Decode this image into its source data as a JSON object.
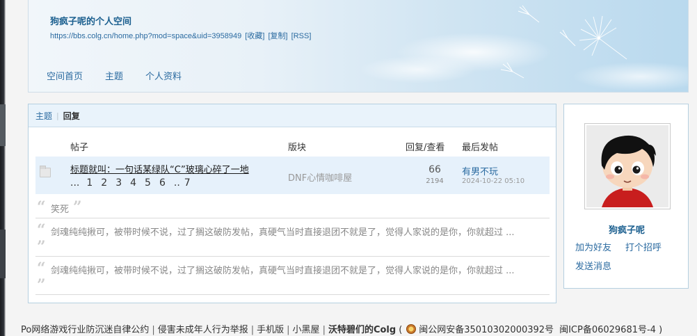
{
  "header": {
    "title": "狗疯子呢的个人空间",
    "url": "https://bbs.colg.cn/home.php?mod=space&uid=3958949",
    "links": [
      "[收藏]",
      "[复制]",
      "[RSS]"
    ],
    "nav": [
      "空间首页",
      "主题",
      "个人资料"
    ]
  },
  "tabs": [
    "主题",
    "回复"
  ],
  "table": {
    "headers": [
      "帖子",
      "版块",
      "回复/查看",
      "最后发帖"
    ],
    "thread": {
      "title": "标题就叫：一句话某绿队“C”玻璃心碎了一地",
      "pages": [
        "...",
        "1",
        "2",
        "3",
        "4",
        "5",
        "6",
        "..",
        "7"
      ],
      "forum": "DNF心情咖啡屋",
      "replies": "66",
      "views": "2194",
      "last_user": "有男不玩",
      "last_time": "2024-10-22 05:10"
    },
    "quotes": [
      "笑死",
      "剑魂纯纯揪可，被带时候不说，过了搁这破防发帖，真硬气当时直接退团不就是了，觉得人家说的是你，你就超过 ...",
      "剑魂纯纯揪可，被带时候不说，过了搁这破防发帖，真硬气当时直接退团不就是了，觉得人家说的是你，你就超过 ..."
    ]
  },
  "sidebar": {
    "username": "狗疯子呢",
    "links": [
      "加为好友",
      "打个招呼",
      "发送消息"
    ]
  },
  "footer": {
    "items": [
      "Po网络游戏行业防沉迷自律公约",
      "侵害未成年人行为举报",
      "手机版",
      "小黑屋"
    ],
    "brand": "沃特碧们的Colg",
    "police": "闽公网安备35010302000392号",
    "icp": "闽ICP备06029681号-4 )"
  }
}
